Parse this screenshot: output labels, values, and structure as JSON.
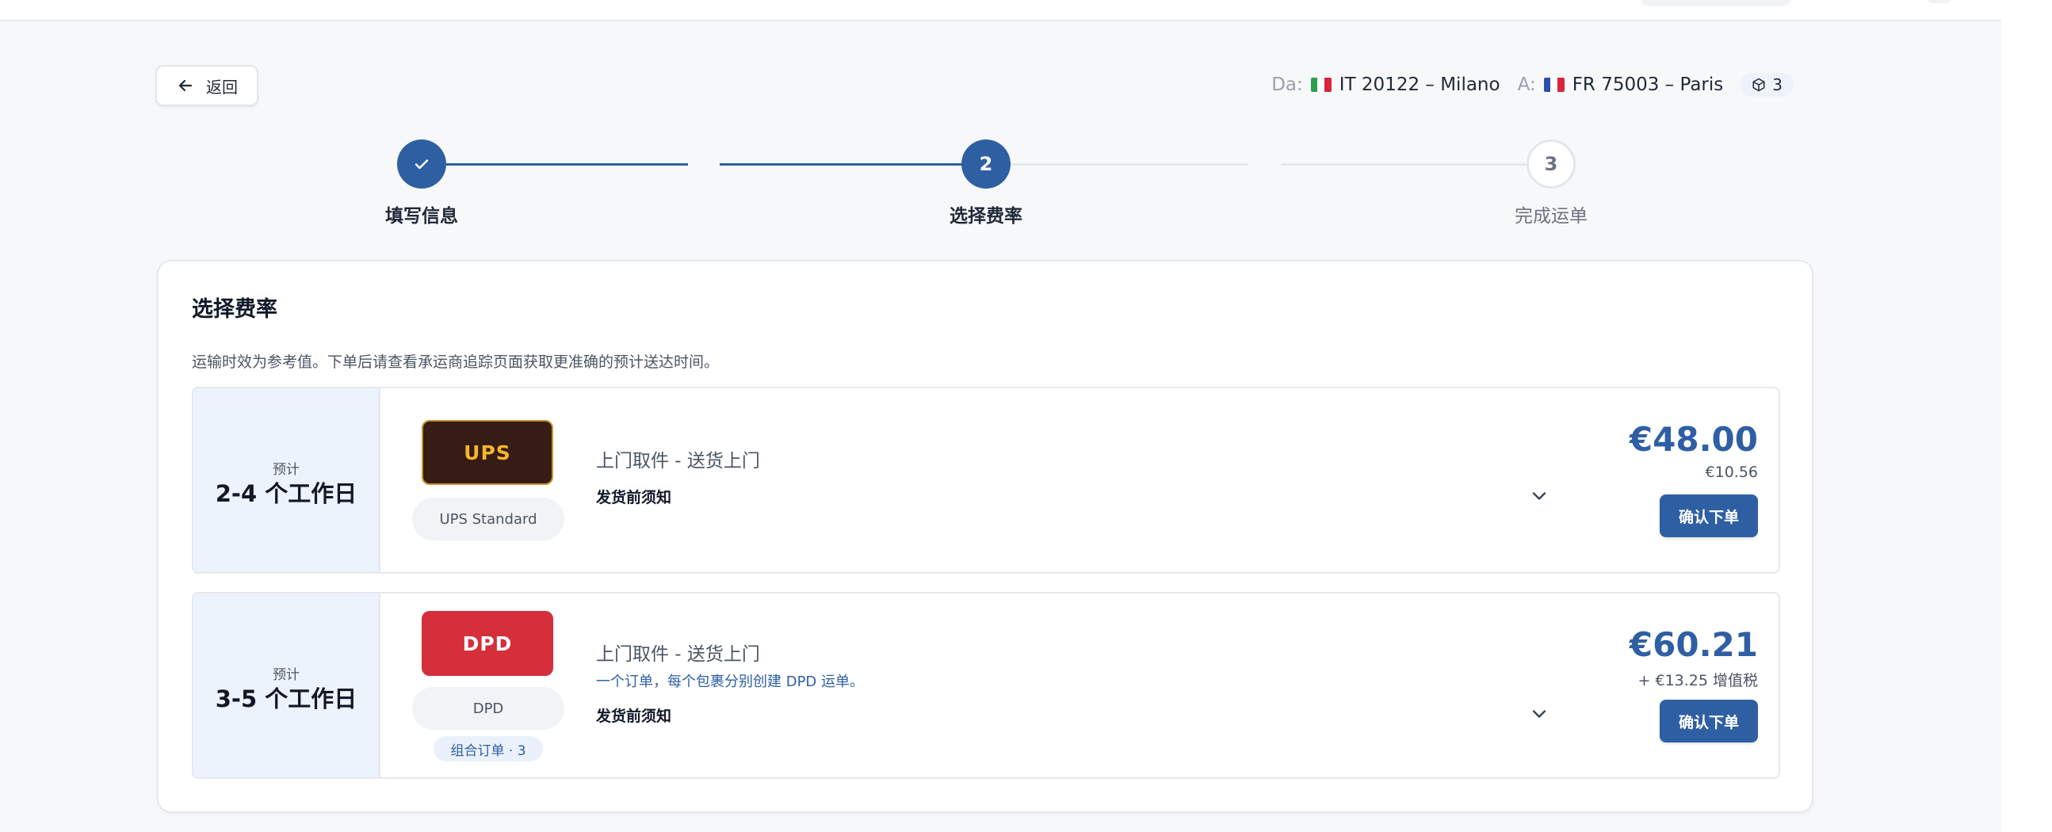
{
  "header": {
    "back_label": "返回"
  },
  "route": {
    "from_label": "Da:",
    "from_value": "IT 20122 – Milano",
    "to_label": "A:",
    "to_value": "FR 75003 – Paris",
    "package_count": "3"
  },
  "stepper": {
    "steps": [
      {
        "number": "1",
        "label": "填写信息",
        "state": "done"
      },
      {
        "number": "2",
        "label": "选择费率",
        "state": "current"
      },
      {
        "number": "3",
        "label": "完成运单",
        "state": "todo"
      }
    ]
  },
  "rates_card": {
    "title": "选择费率",
    "note": "运输时效为参考值。下单后请查看承运商追踪页面获取更准确的预计送达时间。",
    "rates": [
      {
        "eta_label": "预计",
        "eta_days": "2-4 个工作日",
        "carrier_logo": "UPS",
        "service_name": "UPS Standard",
        "service_type": "上门取件 - 送货上门",
        "notice": "发货前须知",
        "price": "€48.00",
        "price_sub": "€10.56",
        "confirm_label": "确认下单"
      },
      {
        "eta_label": "预计",
        "eta_days": "3-5 个工作日",
        "carrier_logo": "DPD",
        "service_name": "DPD",
        "combo_badge": "组合订单 · 3",
        "service_type": "上门取件 - 送货上门",
        "service_subnote": "一个订单，每个包裹分别创建 DPD 运单。",
        "notice": "发货前须知",
        "price": "€60.21",
        "price_sub": "+ €13.25 增值税",
        "confirm_label": "确认下单"
      }
    ]
  },
  "colors": {
    "accent": "#2f5fa3",
    "eta_bg": "#edf3fc",
    "ups_brown": "#351c15",
    "ups_gold": "#f4b52f",
    "dpd_red": "#d42f3b"
  },
  "icons": [
    "arrow-left-icon",
    "italy-flag-icon",
    "france-flag-icon",
    "package-icon",
    "check-icon",
    "chevron-down-icon"
  ]
}
